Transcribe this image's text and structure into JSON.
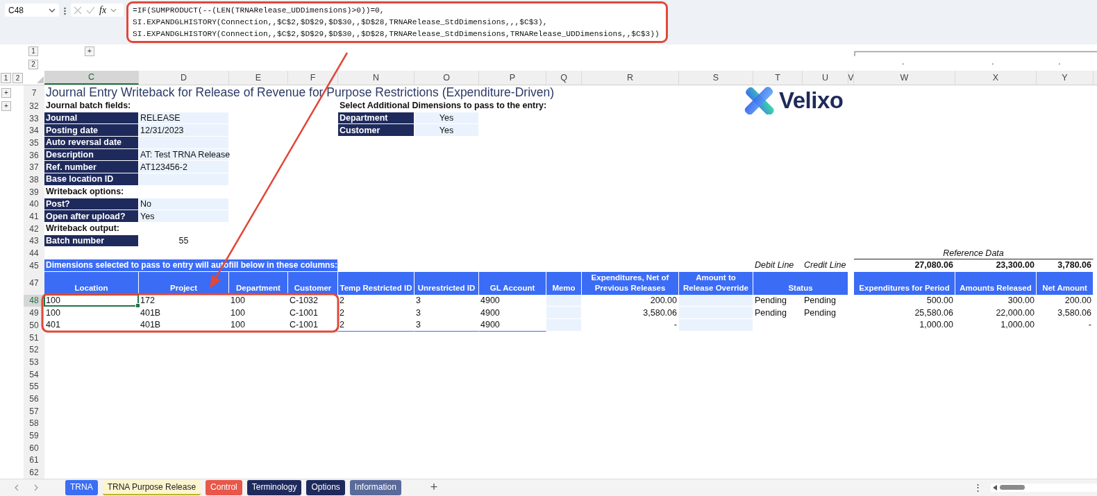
{
  "formula_bar": {
    "name_box": "C48",
    "fx_label": "fx",
    "formula_lines": [
      "=IF(SUMPRODUCT(--(LEN(TRNARelease_UDDimensions)>0))=0,",
      "SI.EXPANDGLHISTORY(Connection,,$C$2,$D$29,$D$30,,$D$28,TRNARelease_StdDimensions,,,$C$3),",
      "SI.EXPANDGLHISTORY(Connection,,$C$2,$D$29,$D$30,,$D$28,TRNARelease_StdDimensions,TRNARelease_UDDimensions,,$C$3))"
    ]
  },
  "outline": {
    "column_levels": [
      "1",
      "2"
    ],
    "column_expand": "+",
    "row_levels": [
      "1",
      "2"
    ]
  },
  "columns": [
    {
      "label": "C",
      "selected": true
    },
    {
      "label": "D",
      "selected": false
    },
    {
      "label": "E",
      "selected": false
    },
    {
      "label": "F",
      "selected": false
    },
    {
      "label": "N",
      "selected": false
    },
    {
      "label": "O",
      "selected": false
    },
    {
      "label": "P",
      "selected": false
    },
    {
      "label": "Q",
      "selected": false
    },
    {
      "label": "R",
      "selected": false
    },
    {
      "label": "S",
      "selected": false
    },
    {
      "label": "T",
      "selected": false
    },
    {
      "label": "U",
      "selected": false
    },
    {
      "label": "V",
      "selected": false
    },
    {
      "label": "W",
      "selected": false
    },
    {
      "label": "X",
      "selected": false
    },
    {
      "label": "Y",
      "selected": false
    }
  ],
  "row_headers": [
    {
      "label": "7",
      "selected": false,
      "expand": "+"
    },
    {
      "label": "32",
      "selected": false,
      "expand": "+"
    },
    {
      "label": "33",
      "selected": false
    },
    {
      "label": "34",
      "selected": false
    },
    {
      "label": "35",
      "selected": false
    },
    {
      "label": "36",
      "selected": false
    },
    {
      "label": "37",
      "selected": false
    },
    {
      "label": "38",
      "selected": false
    },
    {
      "label": "39",
      "selected": false
    },
    {
      "label": "40",
      "selected": false
    },
    {
      "label": "41",
      "selected": false
    },
    {
      "label": "42",
      "selected": false
    },
    {
      "label": "43",
      "selected": false
    },
    {
      "label": "44",
      "selected": false
    },
    {
      "label": "45",
      "selected": false
    },
    {
      "label": "47",
      "selected": false
    },
    {
      "label": "48",
      "selected": true
    },
    {
      "label": "49",
      "selected": false
    },
    {
      "label": "50",
      "selected": false
    },
    {
      "label": "51",
      "selected": false
    },
    {
      "label": "52",
      "selected": false
    },
    {
      "label": "53",
      "selected": false
    },
    {
      "label": "54",
      "selected": false
    },
    {
      "label": "55",
      "selected": false
    },
    {
      "label": "56",
      "selected": false
    },
    {
      "label": "57",
      "selected": false
    },
    {
      "label": "58",
      "selected": false
    },
    {
      "label": "59",
      "selected": false
    },
    {
      "label": "60",
      "selected": false
    },
    {
      "label": "61",
      "selected": false
    },
    {
      "label": "62",
      "selected": false
    }
  ],
  "title": "Journal Entry Writeback for Release of Revenue for Purpose Restrictions (Expenditure-Driven)",
  "logo": {
    "text": "Velixo"
  },
  "batch_sections": [
    {
      "heading": "Journal batch fields:",
      "fields": [
        {
          "label": "Journal",
          "value": "RELEASE",
          "kind": "input"
        },
        {
          "label": "Posting date",
          "value": "12/31/2023",
          "kind": "input"
        },
        {
          "label": "Auto reversal date",
          "kind": "input"
        },
        {
          "label": "Description",
          "value": "AT: Test TRNA Release",
          "kind": "input"
        },
        {
          "label": "Ref. number",
          "value": "AT123456-2",
          "kind": "input"
        },
        {
          "label": "Base location ID",
          "kind": "input"
        }
      ]
    },
    {
      "heading": "Writeback options:",
      "fields": [
        {
          "label": "Post?",
          "value": "No",
          "kind": "input"
        },
        {
          "label": "Open after upload?",
          "value": "Yes",
          "kind": "input"
        }
      ]
    },
    {
      "heading": "Writeback output:",
      "fields": [
        {
          "label": "Batch number",
          "value": "55",
          "kind": "output"
        }
      ]
    }
  ],
  "dimensions": {
    "heading": "Select Additional Dimensions to pass to the entry:",
    "options": [
      {
        "label": "Department",
        "value": "Yes"
      },
      {
        "label": "Customer",
        "value": "Yes"
      }
    ]
  },
  "banner": "Dimensions selected to pass to entry will autofill below in these columns:",
  "table": {
    "columns": [
      "Location",
      "Project",
      "Department",
      "Customer",
      "Temp Restricted ID",
      "Unrestricted ID",
      "GL Account",
      "Memo",
      "Expenditures, Net of Previous Releases",
      "Amount to Release Override",
      "Status"
    ],
    "rows": [
      {
        "location": "100",
        "project": "172",
        "department": "100",
        "customer": "C-1032",
        "temp_restricted_id": "2",
        "unrestricted_id": "3",
        "gl_account": "4900",
        "expenditures_net": "200.00",
        "debit_status": "Pending",
        "credit_status": "Pending",
        "expenditures_for_period": "500.00",
        "amounts_released": "300.00",
        "net_amount": "200.00"
      },
      {
        "location": "100",
        "project": "401B",
        "department": "100",
        "customer": "C-1001",
        "temp_restricted_id": "2",
        "unrestricted_id": "3",
        "gl_account": "4900",
        "expenditures_net": "3,580.06",
        "debit_status": "Pending",
        "credit_status": "Pending",
        "expenditures_for_period": "25,580.06",
        "amounts_released": "22,000.00",
        "net_amount": "3,580.06"
      },
      {
        "location": "401",
        "project": "401B",
        "department": "100",
        "customer": "C-1001",
        "temp_restricted_id": "2",
        "unrestricted_id": "3",
        "gl_account": "4900",
        "expenditures_net": "-",
        "expenditures_for_period": "1,000.00",
        "amounts_released": "1,000.00",
        "net_amount": "-"
      }
    ]
  },
  "reference": {
    "title": "Reference Data",
    "debit_label": "Debit Line",
    "credit_label": "Credit Line",
    "totals": [
      "27,080.06",
      "23,300.00",
      "3,780.06"
    ],
    "columns": [
      "Expenditures for Period",
      "Amounts Released",
      "Net Amount"
    ]
  },
  "sheet_tabs": [
    {
      "label": "TRNA",
      "color": "#3b6ef5",
      "selected": false
    },
    {
      "label": "TRNA Purpose Release",
      "color": "#b5b82a",
      "selected": true
    },
    {
      "label": "Control",
      "color": "#e8574a",
      "selected": false
    },
    {
      "label": "Terminology",
      "color": "#1f2a5c",
      "selected": false
    },
    {
      "label": "Options",
      "color": "#1f2a5c",
      "selected": false
    },
    {
      "label": "Information",
      "color": "#5a6a9a",
      "selected": false
    }
  ],
  "add_sheet": "+",
  "more": "⋮"
}
